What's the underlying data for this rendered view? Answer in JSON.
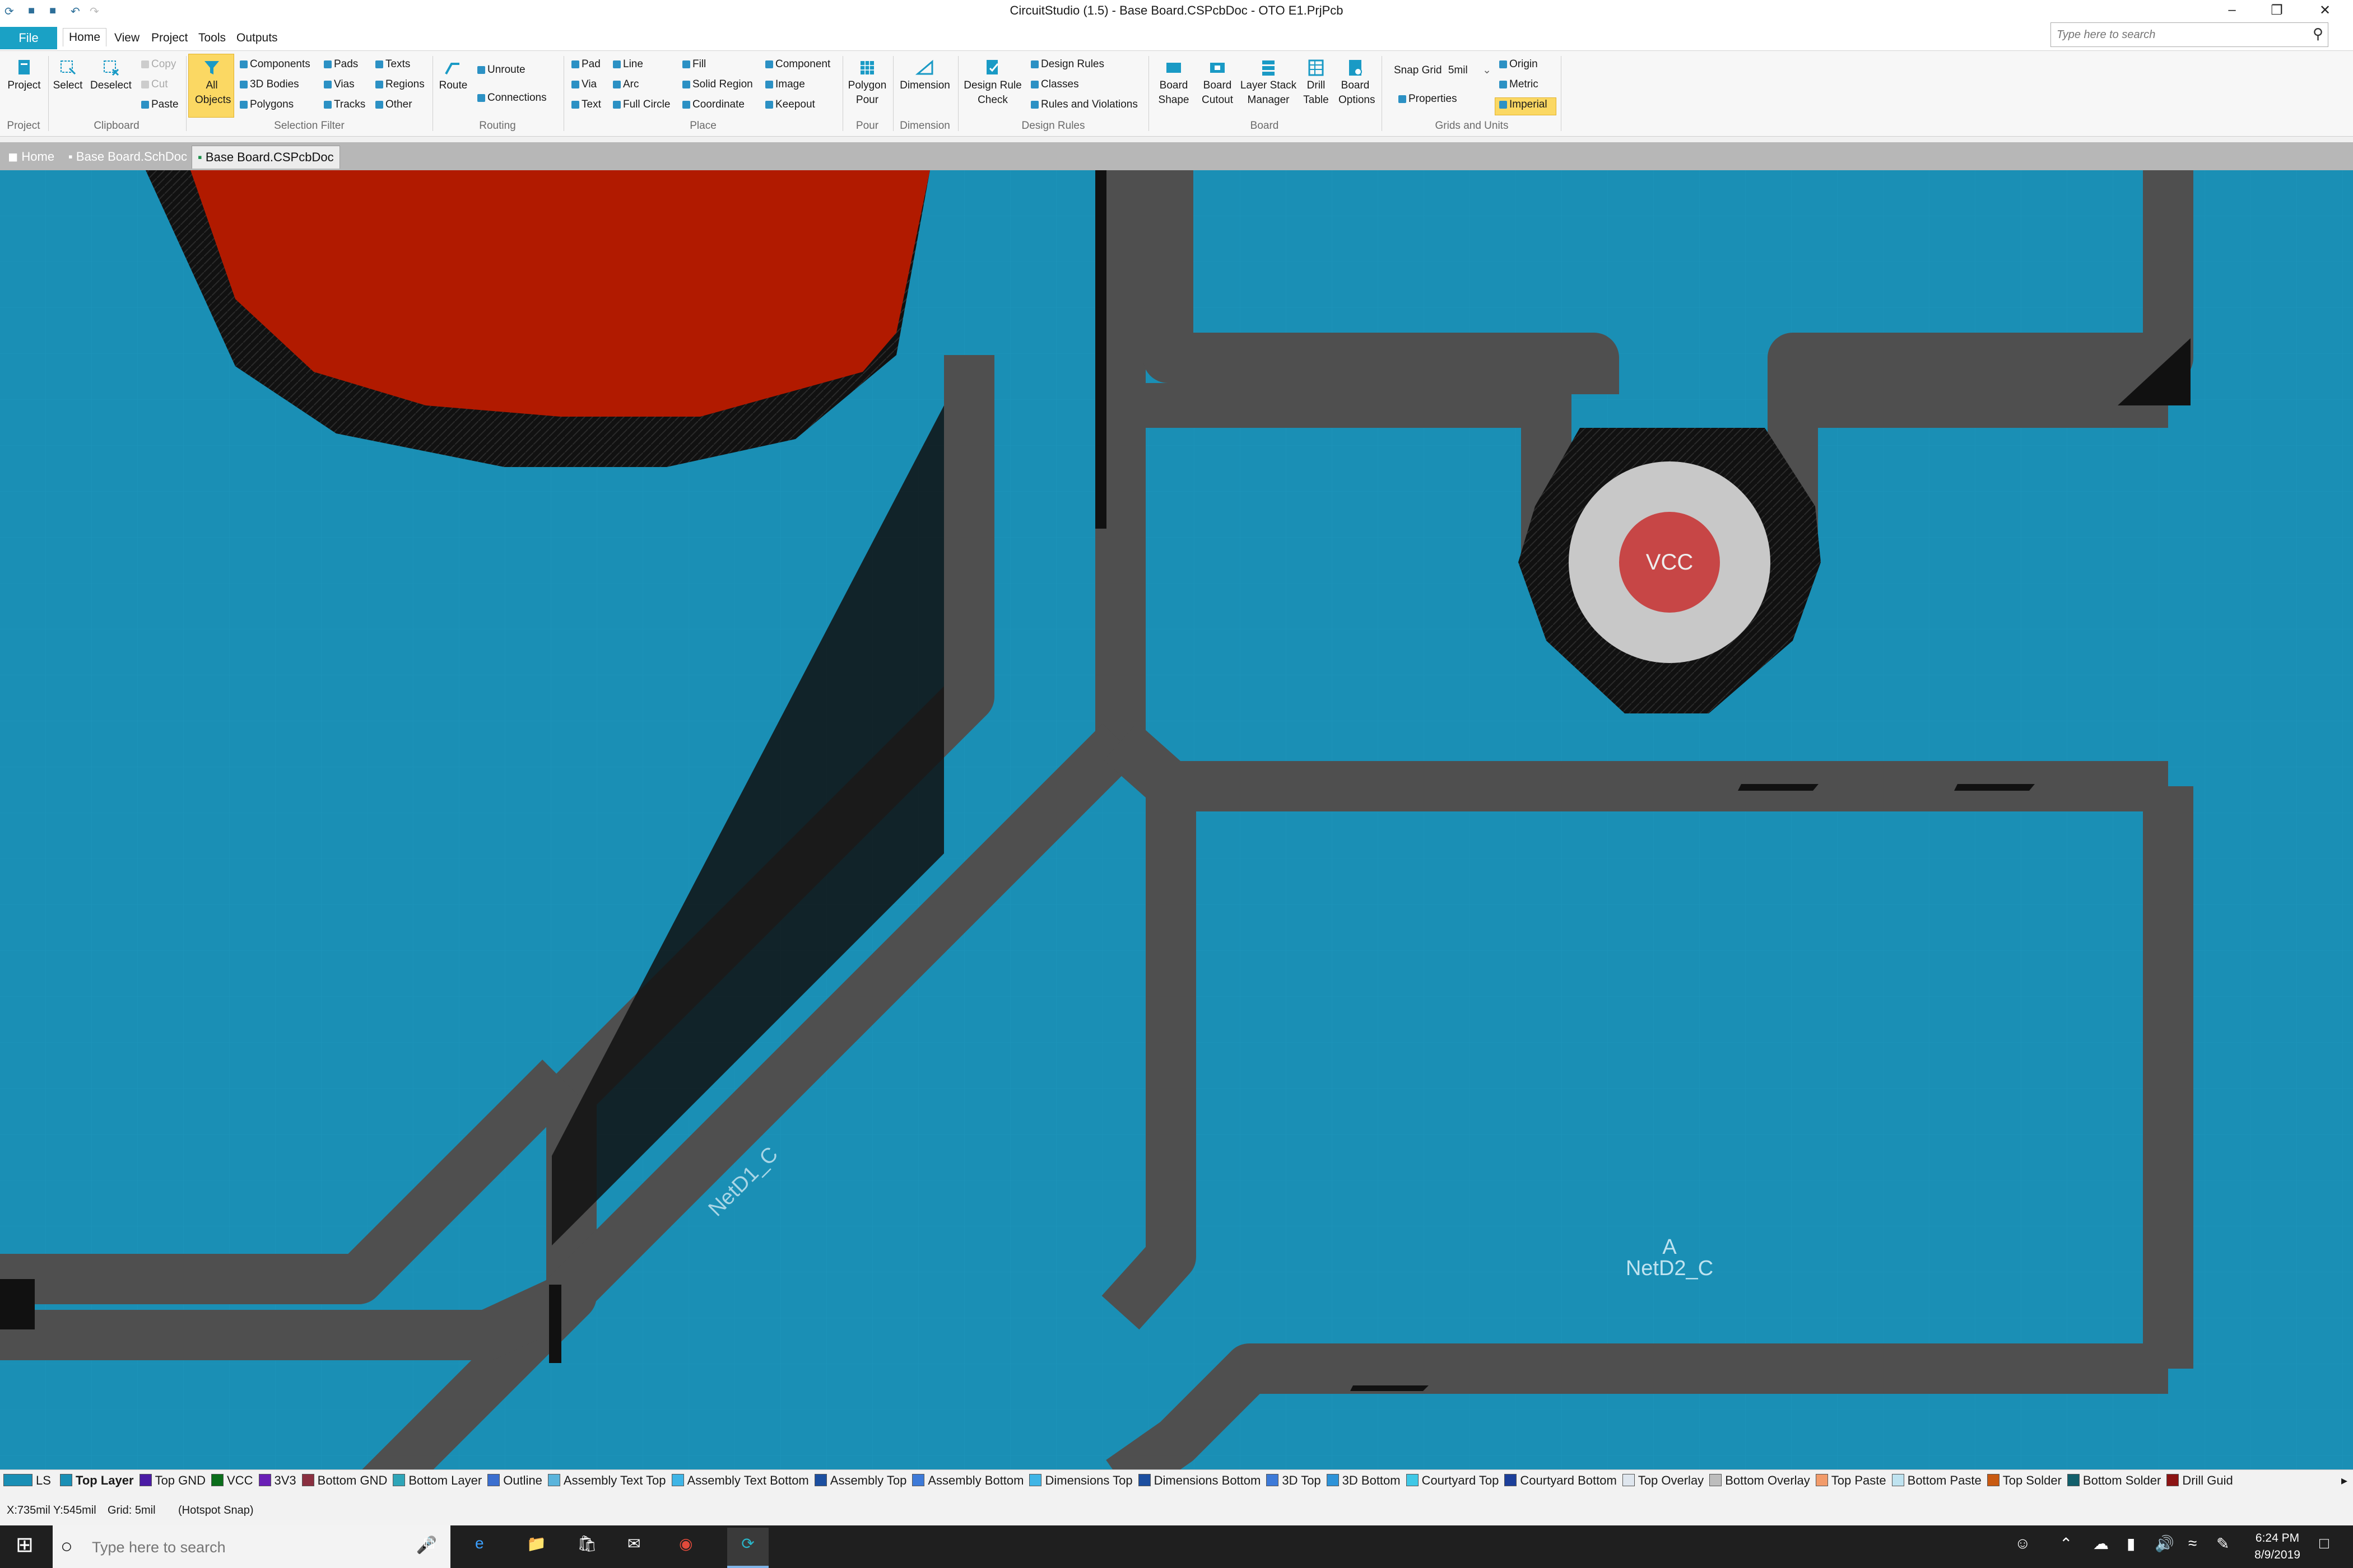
{
  "window": {
    "title": "CircuitStudio (1.5) - Base Board.CSPcbDoc - OTO E1.PrjPcb",
    "search_placeholder": "Type here to search"
  },
  "menu": {
    "file": "File",
    "home": "Home",
    "view": "View",
    "project": "Project",
    "tools": "Tools",
    "outputs": "Outputs"
  },
  "ribbon": {
    "project": {
      "project": "Project",
      "group": "Project"
    },
    "clipboard": {
      "select": "Select",
      "deselect": "Deselect",
      "copy": "Copy",
      "cut": "Cut",
      "paste": "Paste",
      "group": "Clipboard"
    },
    "selection_filter": {
      "all_objects": "All Objects",
      "components": "Components",
      "bodies_3d": "3D Bodies",
      "polygons": "Polygons",
      "pads": "Pads",
      "vias": "Vias",
      "tracks": "Tracks",
      "texts": "Texts",
      "regions": "Regions",
      "other": "Other",
      "group": "Selection Filter"
    },
    "routing": {
      "route": "Route",
      "unroute": "Unroute",
      "connections": "Connections",
      "group": "Routing"
    },
    "place": {
      "pad": "Pad",
      "via": "Via",
      "text": "Text",
      "line": "Line",
      "arc": "Arc",
      "full_circle": "Full Circle",
      "fill": "Fill",
      "solid_region": "Solid Region",
      "coordinate": "Coordinate",
      "component": "Component",
      "image": "Image",
      "keepout": "Keepout",
      "group": "Place"
    },
    "pour": {
      "polygon_pour": "Polygon Pour",
      "group": "Pour"
    },
    "dimension": {
      "dimension": "Dimension",
      "group": "Dimension"
    },
    "design_rules": {
      "drc": "Design Rule Check",
      "design_rules": "Design Rules",
      "classes": "Classes",
      "rules_and_violations": "Rules and Violations",
      "group": "Design Rules"
    },
    "board": {
      "board_shape": "Board Shape",
      "board_cutout": "Board Cutout",
      "layer_stack": "Layer Stack Manager",
      "drill_table": "Drill Table",
      "board_options": "Board Options",
      "group": "Board"
    },
    "grids": {
      "snap_grid_label": "Snap Grid",
      "snap_grid_value": "5mil",
      "properties": "Properties",
      "origin": "Origin",
      "metric": "Metric",
      "imperial": "Imperial",
      "group": "Grids and Units"
    }
  },
  "doc_tabs": {
    "home": "Home",
    "sch": "Base Board.SchDoc",
    "pcb": "Base Board.CSPcbDoc"
  },
  "canvas": {
    "pad_net": "VCC",
    "net_label_1": "NetD1_C",
    "designator": "A",
    "net_label_2": "NetD2_C"
  },
  "colors": {
    "top_layer": "#1a8fb5",
    "track": "#4f4f4f",
    "clearance": "#111111",
    "pad_red": "#b11a00",
    "via_ring": "#c8c8c8",
    "via_hole": "#c74646"
  },
  "layer_tabs": {
    "ls": "LS",
    "items": [
      {
        "name": "Top Layer",
        "color": "#1a8fb5"
      },
      {
        "name": "Top GND",
        "color": "#4b1ba5"
      },
      {
        "name": "VCC",
        "color": "#0b6e1b"
      },
      {
        "name": "3V3",
        "color": "#6a1fb6"
      },
      {
        "name": "Bottom GND",
        "color": "#8a2f40"
      },
      {
        "name": "Bottom Layer",
        "color": "#2ea5b8"
      },
      {
        "name": "Outline",
        "color": "#3b6fcf"
      },
      {
        "name": "Assembly Text Top",
        "color": "#5ab4dc"
      },
      {
        "name": "Assembly Text Bottom",
        "color": "#3fb5e6"
      },
      {
        "name": "Assembly Top",
        "color": "#1c4fa0"
      },
      {
        "name": "Assembly Bottom",
        "color": "#3d7ad8"
      },
      {
        "name": "Dimensions Top",
        "color": "#3fb5e6"
      },
      {
        "name": "Dimensions Bottom",
        "color": "#1c4fa0"
      },
      {
        "name": "3D Top",
        "color": "#3d7ad8"
      },
      {
        "name": "3D Bottom",
        "color": "#2e93d8"
      },
      {
        "name": "Courtyard Top",
        "color": "#3fc8e6"
      },
      {
        "name": "Courtyard Bottom",
        "color": "#1c3f9a"
      },
      {
        "name": "Top Overlay",
        "color": "#dfe6ee"
      },
      {
        "name": "Bottom Overlay",
        "color": "#bdbdbd"
      },
      {
        "name": "Top Paste",
        "color": "#f29b6a"
      },
      {
        "name": "Bottom Paste",
        "color": "#bfe3f0"
      },
      {
        "name": "Top Solder",
        "color": "#c85a12"
      },
      {
        "name": "Bottom Solder",
        "color": "#135f6b"
      },
      {
        "name": "Drill Guid",
        "color": "#8c1414"
      }
    ]
  },
  "status": {
    "coords": "X:735mil Y:545mil",
    "grid": "Grid: 5mil",
    "snap": "(Hotspot Snap)"
  },
  "taskbar": {
    "search_placeholder": "Type here to search",
    "time": "6:24 PM",
    "date": "8/9/2019"
  }
}
